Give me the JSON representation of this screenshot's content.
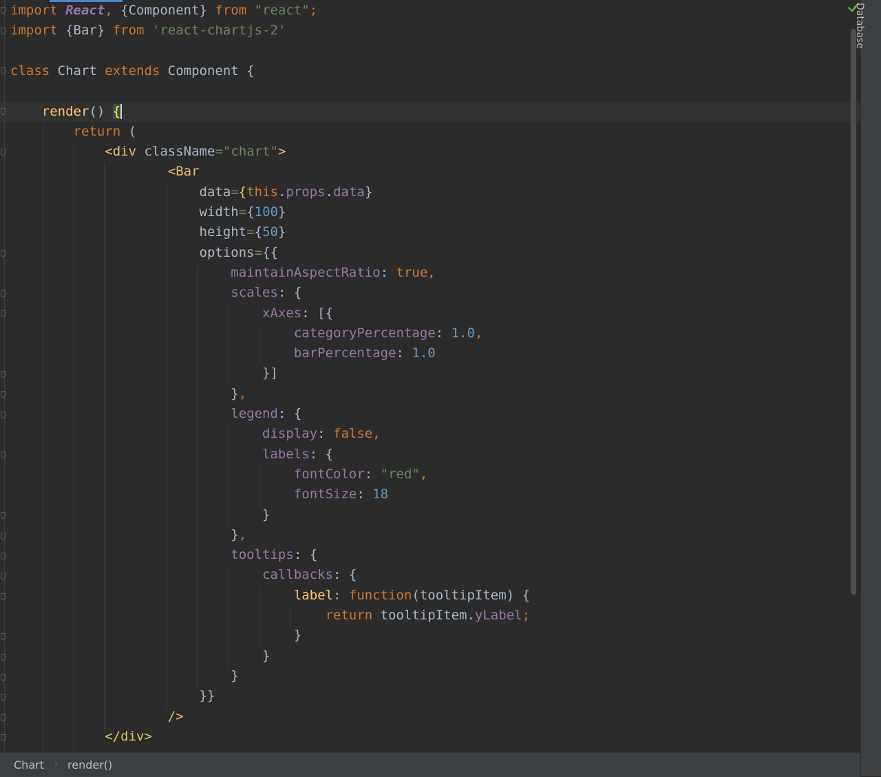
{
  "editor": {
    "lines": [
      [
        {
          "t": "import ",
          "c": "kw"
        },
        {
          "t": "React",
          "c": "it"
        },
        {
          "t": ", ",
          "c": "kw"
        },
        {
          "t": "{Component} ",
          "c": ""
        },
        {
          "t": "from ",
          "c": "kw"
        },
        {
          "t": "\"react\"",
          "c": "str"
        },
        {
          "t": ";",
          "c": "kw"
        }
      ],
      [
        {
          "t": "import ",
          "c": "kw"
        },
        {
          "t": "{Bar} ",
          "c": ""
        },
        {
          "t": "from ",
          "c": "kw"
        },
        {
          "t": "'react-chartjs-2'",
          "c": "str"
        }
      ],
      [],
      [
        {
          "t": "class ",
          "c": "kw"
        },
        {
          "t": "Chart ",
          "c": ""
        },
        {
          "t": "extends ",
          "c": "kw"
        },
        {
          "t": "Component {",
          "c": ""
        }
      ],
      [],
      [
        {
          "t": "    ",
          "c": ""
        },
        {
          "t": "render",
          "c": "fn"
        },
        {
          "t": "() ",
          "c": ""
        },
        {
          "t": "{",
          "c": "brace-hl"
        },
        {
          "t": "",
          "c": "caret"
        }
      ],
      [
        {
          "t": "        ",
          "c": ""
        },
        {
          "t": "return ",
          "c": "kw"
        },
        {
          "t": "(",
          "c": ""
        }
      ],
      [
        {
          "t": "            ",
          "c": ""
        },
        {
          "t": "<div ",
          "c": "tag"
        },
        {
          "t": "className",
          "c": ""
        },
        {
          "t": "=",
          "c": "str"
        },
        {
          "t": "\"chart\"",
          "c": "str"
        },
        {
          "t": ">",
          "c": "tag"
        }
      ],
      [
        {
          "t": "                    ",
          "c": ""
        },
        {
          "t": "<Bar",
          "c": "tag"
        }
      ],
      [
        {
          "t": "                        ",
          "c": ""
        },
        {
          "t": "data",
          "c": ""
        },
        {
          "t": "=",
          "c": "str"
        },
        {
          "t": "{",
          "c": "tag"
        },
        {
          "t": "this",
          "c": "kw"
        },
        {
          "t": ".",
          "c": ""
        },
        {
          "t": "props",
          "c": "prop"
        },
        {
          "t": ".",
          "c": ""
        },
        {
          "t": "data",
          "c": "prop"
        },
        {
          "t": "}",
          "c": ""
        }
      ],
      [
        {
          "t": "                        ",
          "c": ""
        },
        {
          "t": "width",
          "c": ""
        },
        {
          "t": "=",
          "c": "str"
        },
        {
          "t": "{",
          "c": ""
        },
        {
          "t": "100",
          "c": "num"
        },
        {
          "t": "}",
          "c": ""
        }
      ],
      [
        {
          "t": "                        ",
          "c": ""
        },
        {
          "t": "height",
          "c": ""
        },
        {
          "t": "=",
          "c": "str"
        },
        {
          "t": "{",
          "c": ""
        },
        {
          "t": "50",
          "c": "num"
        },
        {
          "t": "}",
          "c": ""
        }
      ],
      [
        {
          "t": "                        ",
          "c": ""
        },
        {
          "t": "options",
          "c": ""
        },
        {
          "t": "=",
          "c": "str"
        },
        {
          "t": "{{",
          "c": ""
        }
      ],
      [
        {
          "t": "                            ",
          "c": ""
        },
        {
          "t": "maintainAspectRatio",
          "c": "prop"
        },
        {
          "t": ": ",
          "c": ""
        },
        {
          "t": "true,",
          "c": "kw"
        }
      ],
      [
        {
          "t": "                            ",
          "c": ""
        },
        {
          "t": "scales",
          "c": "prop"
        },
        {
          "t": ": {",
          "c": ""
        }
      ],
      [
        {
          "t": "                                ",
          "c": ""
        },
        {
          "t": "xAxes",
          "c": "prop"
        },
        {
          "t": ": [{",
          "c": ""
        }
      ],
      [
        {
          "t": "                                    ",
          "c": ""
        },
        {
          "t": "categoryPercentage",
          "c": "prop"
        },
        {
          "t": ": ",
          "c": ""
        },
        {
          "t": "1.0",
          "c": "num"
        },
        {
          "t": ",",
          "c": "kw"
        }
      ],
      [
        {
          "t": "                                    ",
          "c": ""
        },
        {
          "t": "barPercentage",
          "c": "prop"
        },
        {
          "t": ": ",
          "c": ""
        },
        {
          "t": "1.0",
          "c": "num"
        }
      ],
      [
        {
          "t": "                                ",
          "c": ""
        },
        {
          "t": "}]",
          "c": ""
        }
      ],
      [
        {
          "t": "                            ",
          "c": ""
        },
        {
          "t": "}",
          "c": ""
        },
        {
          "t": ",",
          "c": "kw"
        }
      ],
      [
        {
          "t": "                            ",
          "c": ""
        },
        {
          "t": "legend",
          "c": "prop"
        },
        {
          "t": ": {",
          "c": ""
        }
      ],
      [
        {
          "t": "                                ",
          "c": ""
        },
        {
          "t": "display",
          "c": "prop"
        },
        {
          "t": ": ",
          "c": ""
        },
        {
          "t": "false,",
          "c": "kw"
        }
      ],
      [
        {
          "t": "                                ",
          "c": ""
        },
        {
          "t": "labels",
          "c": "prop"
        },
        {
          "t": ": {",
          "c": ""
        }
      ],
      [
        {
          "t": "                                    ",
          "c": ""
        },
        {
          "t": "fontColor",
          "c": "prop"
        },
        {
          "t": ": ",
          "c": ""
        },
        {
          "t": "\"red\"",
          "c": "str"
        },
        {
          "t": ",",
          "c": "kw"
        }
      ],
      [
        {
          "t": "                                    ",
          "c": ""
        },
        {
          "t": "fontSize",
          "c": "prop"
        },
        {
          "t": ": ",
          "c": ""
        },
        {
          "t": "18",
          "c": "num"
        }
      ],
      [
        {
          "t": "                                ",
          "c": ""
        },
        {
          "t": "}",
          "c": ""
        }
      ],
      [
        {
          "t": "                            ",
          "c": ""
        },
        {
          "t": "}",
          "c": ""
        },
        {
          "t": ",",
          "c": "kw"
        }
      ],
      [
        {
          "t": "                            ",
          "c": ""
        },
        {
          "t": "tooltips",
          "c": "prop"
        },
        {
          "t": ": {",
          "c": ""
        }
      ],
      [
        {
          "t": "                                ",
          "c": ""
        },
        {
          "t": "callbacks",
          "c": "prop"
        },
        {
          "t": ": {",
          "c": ""
        }
      ],
      [
        {
          "t": "                                    ",
          "c": ""
        },
        {
          "t": "label",
          "c": "fn"
        },
        {
          "t": ": ",
          "c": ""
        },
        {
          "t": "function",
          "c": "kw"
        },
        {
          "t": "(tooltipItem) {",
          "c": ""
        }
      ],
      [
        {
          "t": "                                        ",
          "c": ""
        },
        {
          "t": "return ",
          "c": "kw"
        },
        {
          "t": "tooltipItem.",
          "c": ""
        },
        {
          "t": "yLabel",
          "c": "prop"
        },
        {
          "t": ";",
          "c": "kw"
        }
      ],
      [
        {
          "t": "                                    ",
          "c": ""
        },
        {
          "t": "}",
          "c": ""
        }
      ],
      [
        {
          "t": "                                ",
          "c": ""
        },
        {
          "t": "}",
          "c": ""
        }
      ],
      [
        {
          "t": "                            ",
          "c": ""
        },
        {
          "t": "}",
          "c": ""
        }
      ],
      [
        {
          "t": "                        ",
          "c": ""
        },
        {
          "t": "}}",
          "c": ""
        }
      ],
      [
        {
          "t": "                    ",
          "c": ""
        },
        {
          "t": "/>",
          "c": "tag"
        }
      ],
      [
        {
          "t": "            ",
          "c": ""
        },
        {
          "t": "</div>",
          "c": "tag"
        }
      ]
    ]
  },
  "breadcrumb": {
    "class_name": "Chart",
    "method_name": "render()"
  },
  "sidebar": {
    "database_label": "Database"
  },
  "status": {
    "inspection_icon": "check-icon"
  },
  "colors": {
    "background": "#2b2b2b",
    "keyword": "#cc7832",
    "string": "#6a8759",
    "number": "#6897bb",
    "property": "#9876aa",
    "function": "#ffc66d"
  }
}
